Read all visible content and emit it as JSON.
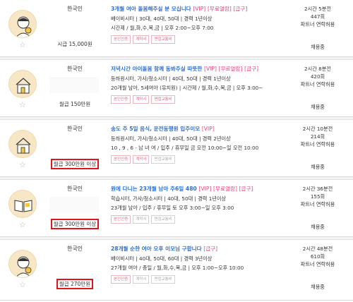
{
  "cards": [
    {
      "nationality": "한국인",
      "wage": "시급 15,000원",
      "wage_highlighted": false,
      "title_main": "3개월 여아 돌봄해주실 분 모십니다",
      "title_tags": [
        "[VIP]",
        "[무료열람]",
        "[급구]"
      ],
      "line1": "베이비시터 | 30대, 40대, 50대 | 경력 1년이상",
      "line2": "시간제 / 월,화,수,목,금 | 오후 2:00~오후 7:00",
      "badges": [
        {
          "label": "본인인증",
          "active": true
        },
        {
          "label": "계약서",
          "active": true
        },
        {
          "label": "면접교통비",
          "active": true
        }
      ],
      "time": "2시간 5분전",
      "count": "447회",
      "request": "파트너 연락허용",
      "status": "채용중",
      "avatar_icon": "baby-sitter-avatar-icon"
    },
    {
      "nationality": "한국인",
      "wage": "월급 150만원",
      "wage_highlighted": false,
      "title_main": "저녁시간 아이돌봄 함께 동봐주실 따뜻한",
      "title_tags": [
        "[VIP]",
        "[무료열람]",
        "[급구]"
      ],
      "line1": "등하원시터, 가사/청소시터 | 40대, 50대 | 경력 1년이상",
      "line2": "20개월 남아, 5세여아 (유치원) | 시간제 / 월,화,수,목,금 | 오후 3:00~",
      "badges": [
        {
          "label": "본인인증",
          "active": true
        },
        {
          "label": "계약서",
          "active": true
        },
        {
          "label": "면접교통비",
          "active": true
        }
      ],
      "time": "2시간 8분전",
      "count": "420회",
      "request": "파트너 연락허용",
      "status": "채용중",
      "avatar_icon": "house-avatar-icon"
    },
    {
      "nationality": "한국인",
      "wage": "월급 300만원 이상",
      "wage_highlighted": true,
      "title_main": "송도 주 5일 음식, 운전동행원 입주이모",
      "title_tags": [
        "[VIP]"
      ],
      "line1": "등하원시터, 가사/청소시터 | 40대, 50대 | 경력 2년이상",
      "line2": "10 , 9 , 6 - 남 녀 여 / 입주 / 휴무일 금 오전 10:00~일 오전 10:00",
      "badges": [
        {
          "label": "본인인증",
          "active": true
        },
        {
          "label": "계약서",
          "active": true
        },
        {
          "label": "면접교통비",
          "active": false
        }
      ],
      "time": "2시간 10분전",
      "count": "214회",
      "request": "파트너 연락허용",
      "status": "채용중",
      "avatar_icon": "house-avatar-icon"
    },
    {
      "nationality": "한국인",
      "wage": "월급 300만원 이상",
      "wage_highlighted": true,
      "title_main": "원에 다니는 23개월 남아 주6일 480",
      "title_tags": [
        "[VIP]",
        "[무료열람]",
        "[급구]"
      ],
      "line1": "학습시터, 가사/청소시터 | 40대, 50대 | 경력 1년이상",
      "line2": "23개월 남아 / 입주 / 휴무일 토 오후 3:00~일 오후 3:00",
      "badges": [
        {
          "label": "본인인증",
          "active": true
        },
        {
          "label": "계약서",
          "active": false
        },
        {
          "label": "면접교통비",
          "active": false
        }
      ],
      "time": "2시간 36분전",
      "count": "155회",
      "request": "파트너 연락허용",
      "status": "채용중",
      "avatar_icon": "book-avatar-icon"
    },
    {
      "nationality": "한국인",
      "wage": "월급 270만원",
      "wage_highlighted": true,
      "title_main": "28개월 순한 여아 오후 이모님 구합니다",
      "title_tags": [
        "[급구]"
      ],
      "line1": "베이비시터 | 40대, 50대, 60대 | 경력 3년이상",
      "line2": "27개월 여아 / 종일 / 월,화,수,목,금 | 오후 1:00~오후 10:00",
      "badges": [
        {
          "label": "본인인증",
          "active": true
        },
        {
          "label": "계약서",
          "active": false
        },
        {
          "label": "면접교통비",
          "active": false
        }
      ],
      "time": "2시간 48분전",
      "count": "610회",
      "request": "파트너 연락허용",
      "status": "채용중",
      "avatar_icon": "baby-sitter-avatar-icon"
    }
  ],
  "colors": {
    "title": "#2f6fd1",
    "tag": "#e7457c",
    "highlight_border": "#e0151d",
    "badge_active": "#d86a86"
  }
}
